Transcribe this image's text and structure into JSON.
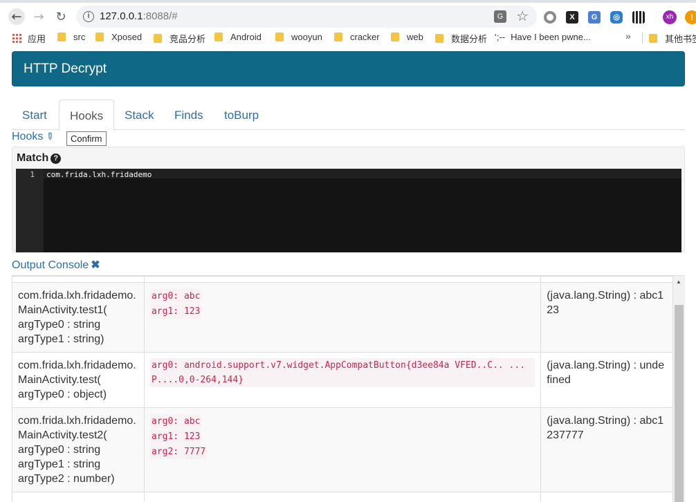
{
  "browser": {
    "url_host": "127.0.0.1",
    "url_rest": ":8088/#",
    "nav": {
      "back": "←",
      "forward": "→",
      "reload": "↻"
    },
    "avatar_initials": "xh",
    "bookmarks": [
      "应用",
      "src",
      "Xposed",
      "竞品分析",
      "Android",
      "wooyun",
      "cracker",
      "web",
      "数据分析",
      "Have I been pwne...",
      "其他书签"
    ],
    "bookmark_more": "»",
    "bookmark_prefix": "‘;--"
  },
  "header": {
    "title": "HTTP Decrypt"
  },
  "tabs": [
    {
      "label": "Start"
    },
    {
      "label": "Hooks"
    },
    {
      "label": "Stack"
    },
    {
      "label": "Finds"
    },
    {
      "label": "toBurp"
    }
  ],
  "hooks": {
    "label": "Hooks",
    "tooltip": "Confirm"
  },
  "match": {
    "title": "Match",
    "line_number": "1",
    "code": "com.frida.lxh.fridademo"
  },
  "console": {
    "label": "Output Console",
    "rows": [
      {
        "fn": [
          "com.frida.lxh.fridademo.",
          "MainActivity.test1(",
          "argType0 : string",
          "argType1 : string)"
        ],
        "args": [
          "arg0: abc",
          "arg1: 123"
        ],
        "ret": "(java.lang.String) : abc123"
      },
      {
        "fn": [
          "com.frida.lxh.fridademo.",
          "MainActivity.test(",
          "argType0 : object)"
        ],
        "args": [
          "arg0: android.support.v7.widget.AppCompatButton{d3ee84a VFED..C.. ...P....0,0-264,144}"
        ],
        "ret": "(java.lang.String) : undefined"
      },
      {
        "fn": [
          "com.frida.lxh.fridademo.",
          "MainActivity.test2(",
          "argType0 : string",
          "argType1 : string",
          "argType2 : number)"
        ],
        "args": [
          "arg0: abc",
          "arg1: 123",
          "arg2: 7777"
        ],
        "ret": "(java.lang.String) : abc1237777"
      }
    ]
  }
}
